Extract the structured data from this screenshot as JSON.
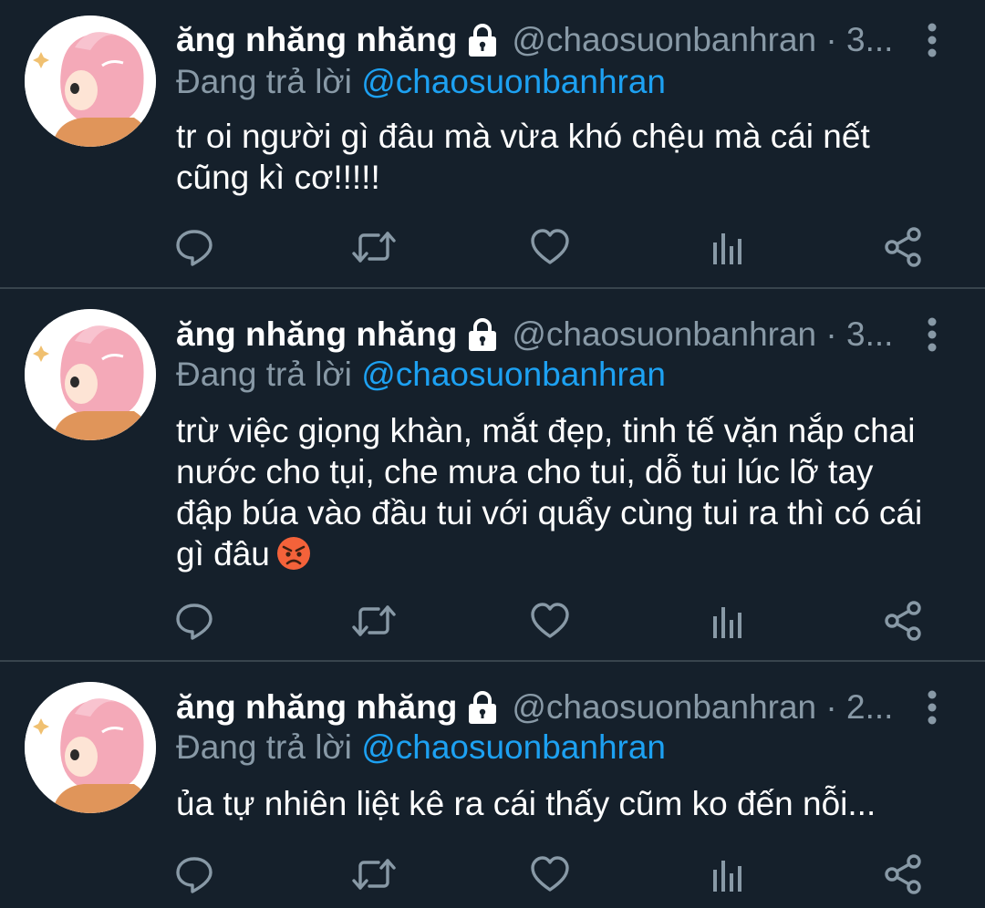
{
  "tweets": [
    {
      "display_name": "ăng nhăng nhăng",
      "handle_time": "@chaosuonbanhran · 3...",
      "reply_prefix": "Đang trả lời",
      "reply_mention": "@chaosuonbanhran",
      "text": "tr oi người gì đâu mà vừa khó chệu mà cái nết\ncũng kì cơ!!!!!",
      "emoji": ""
    },
    {
      "display_name": "ăng nhăng nhăng",
      "handle_time": "@chaosuonbanhran · 3...",
      "reply_prefix": "Đang trả lời",
      "reply_mention": "@chaosuonbanhran",
      "text": "trừ việc giọng khàn, mắt đẹp, tinh tế vặn nắp chai\nnước cho tụi, che mưa cho tui, dỗ tui lúc lỡ tay\nđập búa vào đầu tui với quẩy cùng tui ra thì có cái\ngì đâu",
      "emoji": "angry-face"
    },
    {
      "display_name": "ăng nhăng nhăng",
      "handle_time": "@chaosuonbanhran · 2...",
      "reply_prefix": "Đang trả lời",
      "reply_mention": "@chaosuonbanhran",
      "text": "ủa tự nhiên liệt kê ra cái thấy cũm ko đến nỗi...",
      "emoji": ""
    }
  ],
  "icons": {
    "lock": "lock-icon",
    "more": "more-vertical-icon",
    "reply": "reply-icon",
    "retweet": "retweet-icon",
    "like": "like-icon",
    "analytics": "analytics-icon",
    "share": "share-icon"
  },
  "colors": {
    "background": "#15202b",
    "divider": "#38444d",
    "muted": "#8899a6",
    "link": "#1da1f2",
    "text": "#ffffff"
  }
}
